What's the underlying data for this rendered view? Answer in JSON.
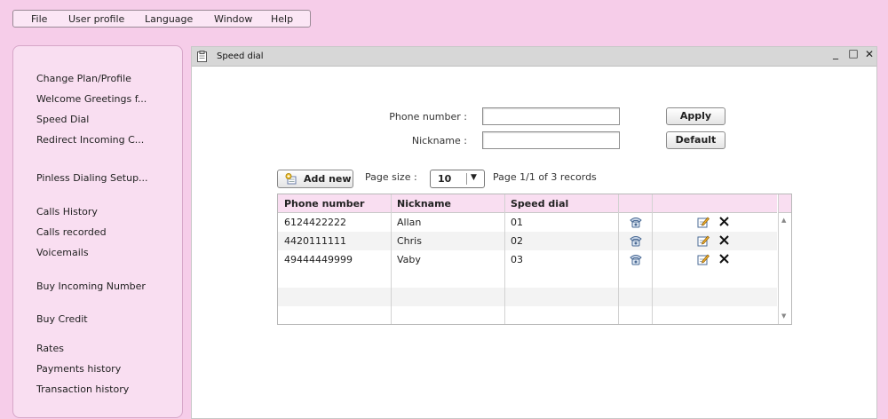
{
  "menu": {
    "items": [
      "File",
      "User profile",
      "Language",
      "Window",
      "Help"
    ]
  },
  "sidebar": {
    "items": [
      "Change Plan/Profile",
      "Welcome Greetings f...",
      "Speed Dial",
      "Redirect Incoming C...",
      "Pinless Dialing Setup...",
      "Calls History",
      "Calls recorded",
      "Voicemails",
      "Buy Incoming Number",
      "Buy Credit",
      "Rates",
      "Payments history",
      "Transaction history"
    ]
  },
  "window": {
    "title": "Speed dial",
    "minimize": "_",
    "maximize": "□",
    "close": "✕"
  },
  "filter": {
    "phone_label": "Phone number :",
    "phone_value": "",
    "nickname_label": "Nickname :",
    "nickname_value": "",
    "apply_label": "Apply",
    "default_label": "Default"
  },
  "toolbar": {
    "add_new_label": "Add new",
    "page_size_label": "Page size :",
    "page_size_value": "10",
    "page_info": "Page 1/1 of 3 records"
  },
  "grid": {
    "columns": [
      "Phone number",
      "Nickname",
      "Speed dial",
      "",
      ""
    ],
    "rows": [
      {
        "phone": "6124422222",
        "nickname": "Allan",
        "speed_dial": "01"
      },
      {
        "phone": "4420111111",
        "nickname": "Chris",
        "speed_dial": "02"
      },
      {
        "phone": "49444449999",
        "nickname": "Vaby",
        "speed_dial": "03"
      }
    ],
    "icons": {
      "call": "phone-icon",
      "edit": "edit-icon",
      "delete": "delete-icon"
    }
  }
}
